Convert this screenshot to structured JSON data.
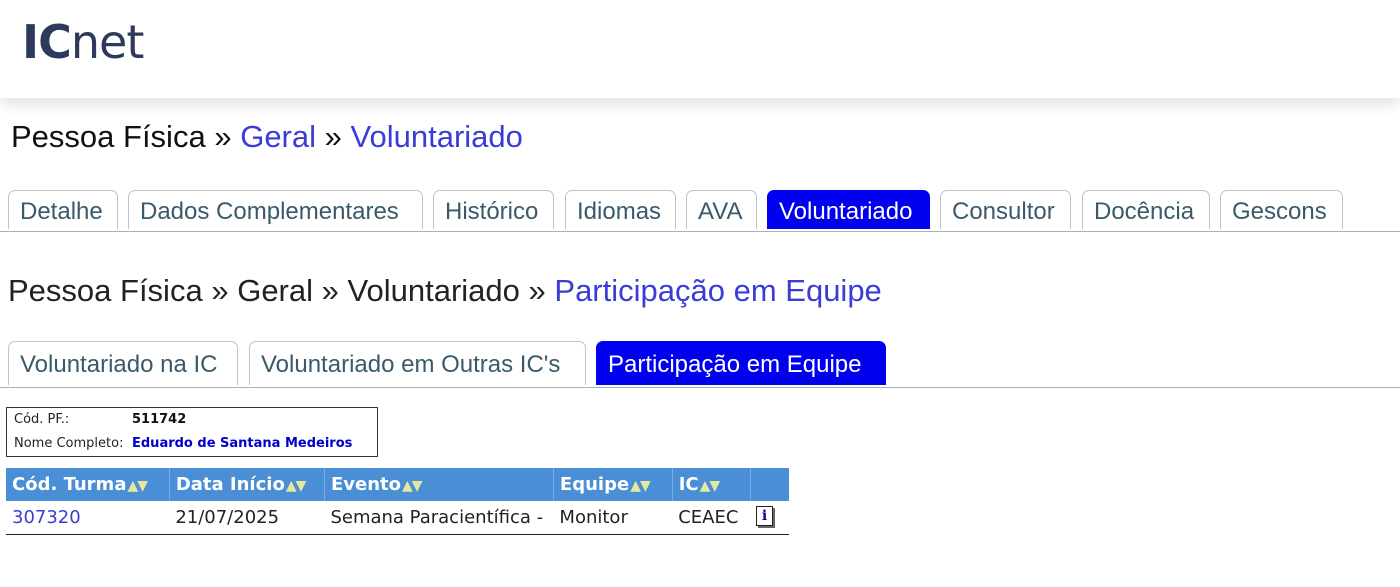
{
  "app": {
    "logo_ic": "IC",
    "logo_net": "net"
  },
  "breadcrumb_top": {
    "part1": "Pessoa Física",
    "sep": "»",
    "part2": "Geral",
    "part3": "Voluntariado"
  },
  "tabs_main": [
    {
      "label": "Detalhe"
    },
    {
      "label": "Dados Complementares"
    },
    {
      "label": "Histórico"
    },
    {
      "label": "Idiomas"
    },
    {
      "label": "AVA"
    },
    {
      "label": "Voluntariado",
      "active": true
    },
    {
      "label": "Consultor"
    },
    {
      "label": "Docência"
    },
    {
      "label": "Gescons"
    }
  ],
  "breadcrumb_sub": {
    "part1": "Pessoa Física",
    "sep": "»",
    "part2": "Geral",
    "part3": "Voluntariado",
    "part4": "Participação em Equipe"
  },
  "tabs_sub": [
    {
      "label": "Voluntariado na IC"
    },
    {
      "label": "Voluntariado em Outras IC's"
    },
    {
      "label": "Participação em Equipe",
      "active": true
    }
  ],
  "person": {
    "cod_label": "Cód. PF.:",
    "cod_value": "511742",
    "name_label": "Nome Completo:",
    "name_value": "Eduardo de Santana Medeiros"
  },
  "table": {
    "sort_glyph": "▲▼",
    "headers": [
      "Cód. Turma",
      "Data Início",
      "Evento",
      "Equipe",
      "IC"
    ],
    "rows": [
      [
        "307320",
        "21/07/2025",
        "Semana Paracientífica -",
        "Monitor",
        "CEAEC"
      ]
    ],
    "row_icon": "info-icon",
    "row_icon_glyph": "i"
  },
  "colors": {
    "active_tab": "#0000ee",
    "link": "#3b3bd6",
    "table_header": "#4a8fd6",
    "logo": "#2e3a5c"
  }
}
